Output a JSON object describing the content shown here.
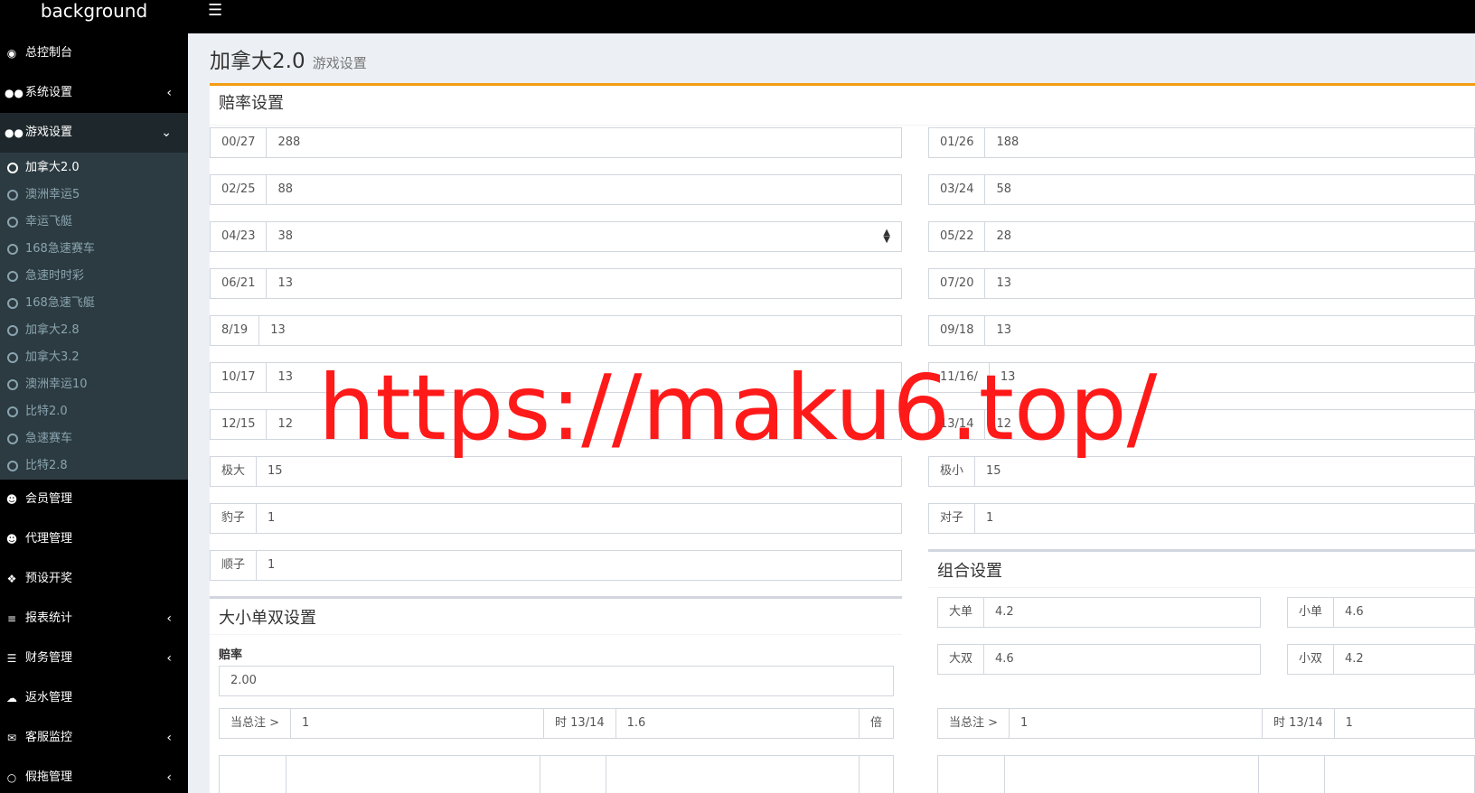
{
  "brand": "background",
  "menu_toggle_icon": "hamburger-icon",
  "sidebar": {
    "items_top": [
      {
        "label": "总控制台",
        "icon": "dashboard-icon"
      },
      {
        "label": "系统设置",
        "icon": "gamepad-icon",
        "chevron": "‹"
      },
      {
        "label": "游戏设置",
        "icon": "gamepad-icon",
        "chevron": "⌄"
      }
    ],
    "sub_items": [
      "加拿大2.0",
      "澳洲幸运5",
      "幸运飞艇",
      "168急速赛车",
      "急速时时彩",
      "168急速飞艇",
      "加拿大2.8",
      "加拿大3.2",
      "澳洲幸运10",
      "比特2.0",
      "急速赛车",
      "比特2.8"
    ],
    "items_bottom": [
      {
        "label": "会员管理",
        "icon": "users-icon"
      },
      {
        "label": "代理管理",
        "icon": "users-icon"
      },
      {
        "label": "预设开奖",
        "icon": "cubes-icon"
      },
      {
        "label": "报表统计",
        "icon": "list-icon",
        "chevron": "‹"
      },
      {
        "label": "财务管理",
        "icon": "database-icon",
        "chevron": "‹"
      },
      {
        "label": "返水管理",
        "icon": "cloud-download-icon"
      },
      {
        "label": "客服监控",
        "icon": "comments-icon",
        "chevron": "‹"
      },
      {
        "label": "假拖管理",
        "icon": "comment-icon",
        "chevron": "‹"
      }
    ]
  },
  "header": {
    "title": "加拿大2.0",
    "subtitle": "游戏设置"
  },
  "odds": {
    "title": "赔率设置",
    "left": [
      {
        "label": "00/27",
        "value": "288"
      },
      {
        "label": "02/25",
        "value": "88"
      },
      {
        "label": "04/23",
        "value": "38"
      },
      {
        "label": "06/21",
        "value": "13"
      },
      {
        "label": "8/19",
        "value": "13"
      },
      {
        "label": "10/17",
        "value": "13"
      },
      {
        "label": "12/15",
        "value": "12"
      },
      {
        "label": "极大",
        "value": "15"
      },
      {
        "label": "豹子",
        "value": "1"
      },
      {
        "label": "顺子",
        "value": "1"
      }
    ],
    "right": [
      {
        "label": "01/26",
        "value": "188"
      },
      {
        "label": "03/24",
        "value": "58"
      },
      {
        "label": "05/22",
        "value": "28"
      },
      {
        "label": "07/20",
        "value": "13"
      },
      {
        "label": "09/18",
        "value": "13"
      },
      {
        "label": "11/16/",
        "value": "13"
      },
      {
        "label": "13/14",
        "value": "12"
      },
      {
        "label": "极小",
        "value": "15"
      },
      {
        "label": "对子",
        "value": "1"
      }
    ]
  },
  "size": {
    "title": "大小单双设置",
    "rate_label": "赔率",
    "rate_value": "2.00",
    "row": {
      "left_label": "当总注 >",
      "left_value": "1",
      "mid_label": "时 13/14",
      "mid_value": "1.6",
      "unit": "倍"
    }
  },
  "combo": {
    "title": "组合设置",
    "items": [
      {
        "label": "大单",
        "value": "4.2"
      },
      {
        "label": "小单",
        "value": "4.6"
      },
      {
        "label": "大双",
        "value": "4.6"
      },
      {
        "label": "小双",
        "value": "4.2"
      }
    ],
    "row": {
      "left_label": "当总注 >",
      "left_value": "1",
      "mid_label": "时 13/14",
      "mid_value": "1"
    }
  },
  "watermark": "https://maku6.top/"
}
